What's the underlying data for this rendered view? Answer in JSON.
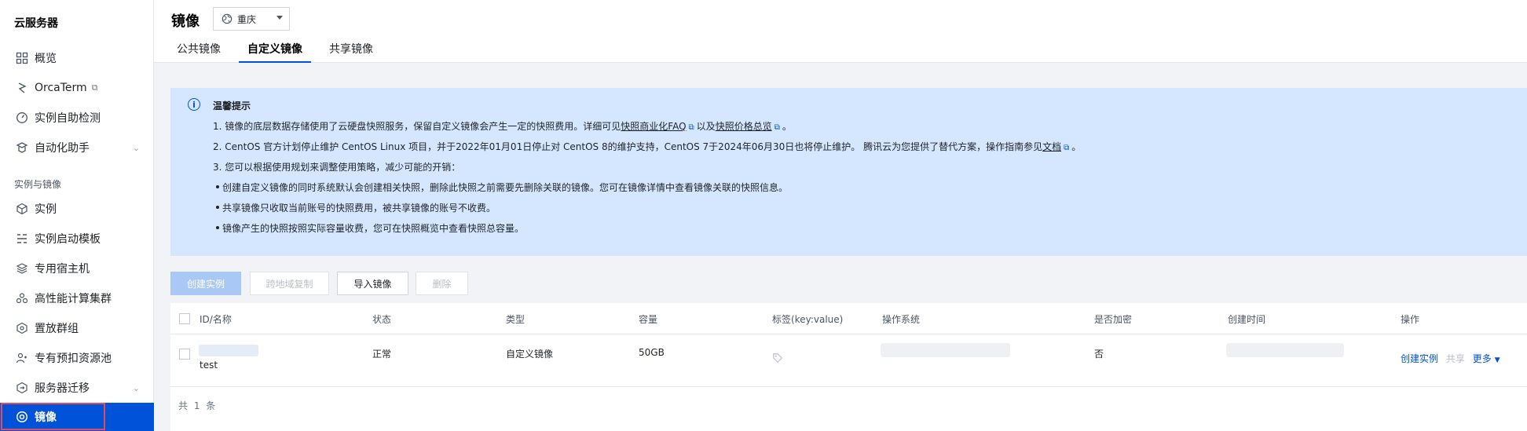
{
  "sidebar": {
    "title": "云服务器",
    "items_top": [
      {
        "label": "概览",
        "icon": "grid-icon"
      },
      {
        "label": "OrcaTerm",
        "icon": "orca-icon",
        "external": true
      },
      {
        "label": "实例自助检测",
        "icon": "gauge-icon"
      },
      {
        "label": "自动化助手",
        "icon": "robot-icon",
        "expandable": true
      }
    ],
    "section_label": "实例与镜像",
    "items": [
      {
        "label": "实例",
        "icon": "cube-icon"
      },
      {
        "label": "实例启动模板",
        "icon": "template-icon"
      },
      {
        "label": "专用宿主机",
        "icon": "layers-icon"
      },
      {
        "label": "高性能计算集群",
        "icon": "cluster-icon"
      },
      {
        "label": "置放群组",
        "icon": "placement-icon"
      },
      {
        "label": "专有预扣资源池",
        "icon": "pool-icon"
      },
      {
        "label": "服务器迁移",
        "icon": "migrate-icon",
        "expandable": true
      },
      {
        "label": "镜像",
        "icon": "image-icon",
        "active": true
      }
    ]
  },
  "header": {
    "title": "镜像",
    "region": "重庆",
    "tabs": [
      {
        "label": "公共镜像"
      },
      {
        "label": "自定义镜像",
        "active": true
      },
      {
        "label": "共享镜像"
      }
    ]
  },
  "notice": {
    "title": "温馨提示",
    "line1_a": "1. 镜像的底层数据存储使用了云硬盘快照服务，保留自定义镜像会产生一定的快照费用。详细可见",
    "line1_link1": "快照商业化FAQ",
    "line1_mid": "以及",
    "line1_link2": "快照价格总览",
    "line1_end": "。",
    "line2_a": "2. CentOS 官方计划停止维护 CentOS Linux 项目，并于2022年01月01日停止对 CentOS 8的维护支持，CentOS 7于2024年06月30日也将停止维护。 腾讯云为您提供了替代方案，操作指南参见",
    "line2_link": "文档",
    "line2_end": "。",
    "line3": "3. 您可以根据使用规划来调整使用策略，减少可能的开销：",
    "bullets": [
      "创建自定义镜像的同时系统默认会创建相关快照，删除此快照之前需要先删除关联的镜像。您可在镜像详情中查看镜像关联的快照信息。",
      "共享镜像只收取当前账号的快照费用，被共享镜像的账号不收费。",
      "镜像产生的快照按照实际容量收费，您可在快照概览中查看快照总容量。"
    ]
  },
  "toolbar": {
    "create_instance": "创建实例",
    "cross_region_copy": "跨地域复制",
    "import_image": "导入镜像",
    "delete": "删除"
  },
  "table": {
    "columns": {
      "id_name": "ID/名称",
      "status": "状态",
      "type": "类型",
      "capacity": "容量",
      "tags": "标签(key:value)",
      "os": "操作系统",
      "encrypted": "是否加密",
      "created": "创建时间",
      "actions": "操作"
    },
    "rows": [
      {
        "name": "test",
        "status": "正常",
        "type": "自定义镜像",
        "capacity": "50GB",
        "encrypted": "否",
        "action_create": "创建实例",
        "action_share": "共享",
        "action_more": "更多"
      }
    ],
    "total": "共 1 条"
  }
}
